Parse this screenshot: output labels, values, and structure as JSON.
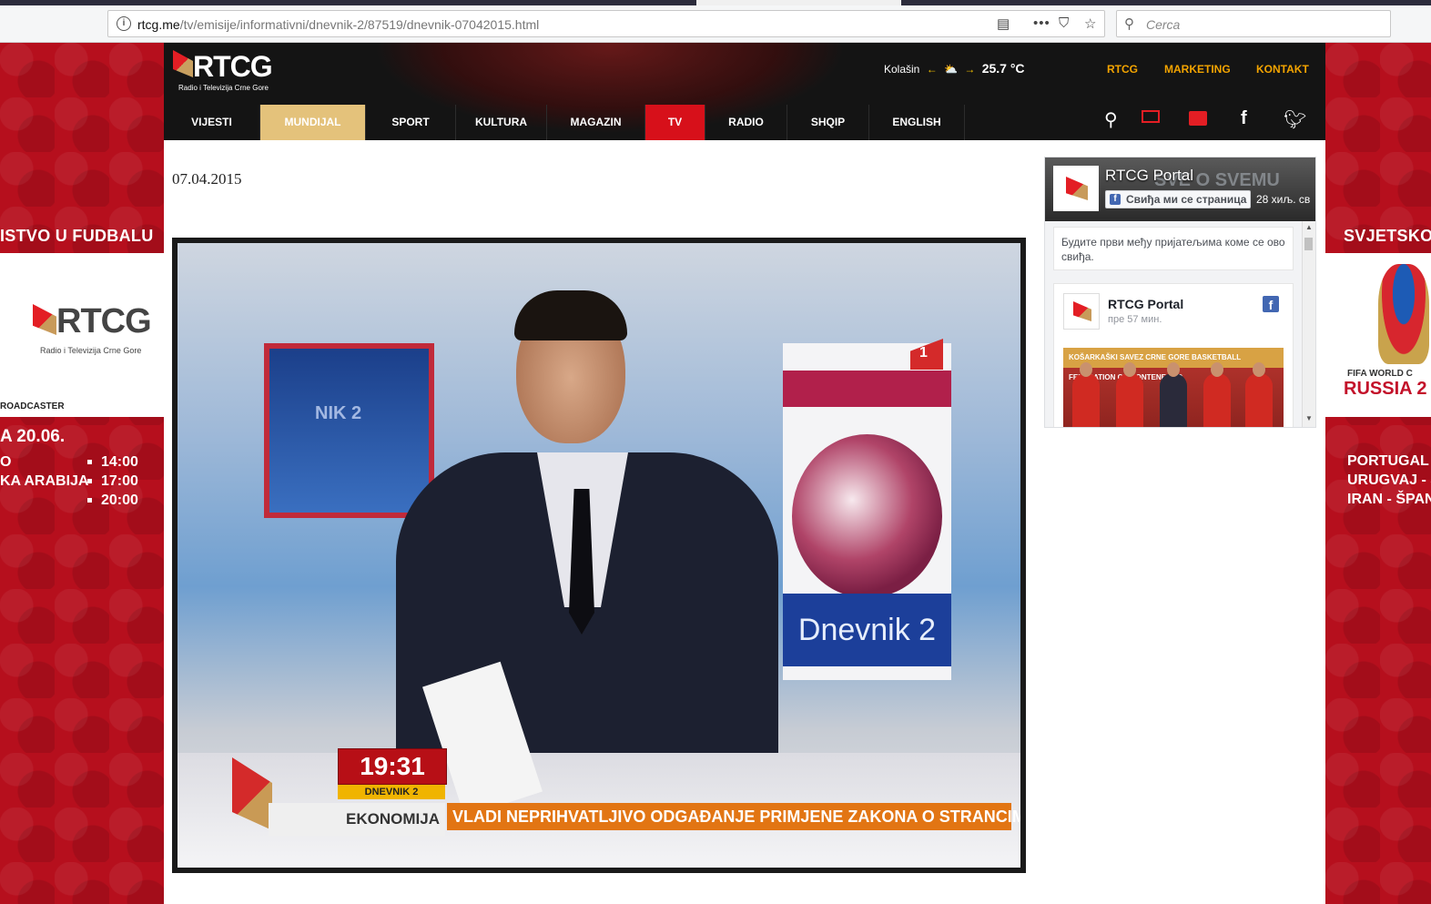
{
  "browser": {
    "url_domain": "rtcg.me",
    "url_path": "/tv/emisije/informativni/dnevnik-2/87519/dnevnik-07042015.html",
    "search_placeholder": "Cerca"
  },
  "ad_left": {
    "title": "ISTVO U FUDBALU",
    "brand": "RTCG",
    "brand_sub": "Radio i Televizija Crne Gore",
    "broadcaster": "ROADCASTER",
    "date": "A 20.06.",
    "matches": [
      {
        "team": "O",
        "time": "14:00"
      },
      {
        "team": "KA ARABIJA",
        "time": "17:00"
      },
      {
        "team": "",
        "time": "20:00"
      }
    ]
  },
  "ad_right": {
    "title": "SVJETSKO",
    "fifa_line1": "FIFA WORLD C",
    "fifa_line2": "RUSSIA 2",
    "matches": [
      "PORTUGAL -",
      "URUGVAJ - S",
      "IRAN - ŠPAN"
    ]
  },
  "header": {
    "logo_word": "RTCG",
    "logo_sub": "Radio i Televizija Crne Gore",
    "weather_city": "Kolašin",
    "weather_temp": "25.7 °C",
    "top_links": [
      "RTCG",
      "MARKETING",
      "KONTAKT"
    ],
    "nav": [
      "VIJESTI",
      "MUNDIJAL",
      "SPORT",
      "KULTURA",
      "MAGAZIN",
      "TV",
      "RADIO",
      "SHQIP",
      "ENGLISH"
    ],
    "icons": [
      "search-icon",
      "tv-icon",
      "radio-icon",
      "facebook-icon",
      "twitter-icon"
    ]
  },
  "article": {
    "date": "07.04.2015"
  },
  "video": {
    "screen_label": "NIK 2",
    "channel_logo": "1",
    "studio_sign": "Dnevnik 2",
    "time": "19:31",
    "program": "DNEVNIK 2",
    "section": "EKONOMIJA",
    "headline": "VLADI NEPRIHVATLJIVO ODGAĐANJE PRIMJENE ZAKONA O STRANCIMA"
  },
  "fb_widget": {
    "cover_text": "SVE O SVEMU",
    "page_name": "RTCG Portal",
    "like_button": "Свиђа ми се страница",
    "like_count": "28 хиљ. св",
    "friends_text": "Будите први међу пријатељима коме се ово свиђа.",
    "post_author": "RTCG Portal",
    "post_time": "пре 57 мин.",
    "photo_banner": "KOŠARKAŠKI SAVEZ CRNE GORE   BASKETBALL FEDERATION OF MONTENEGRO"
  },
  "colors": {
    "header_bg": "#141414",
    "accent_red": "#d7101a",
    "mundijal_gold": "#e4c27b",
    "toplink_orange": "#f3a400",
    "ad_red": "#b60f1d"
  }
}
